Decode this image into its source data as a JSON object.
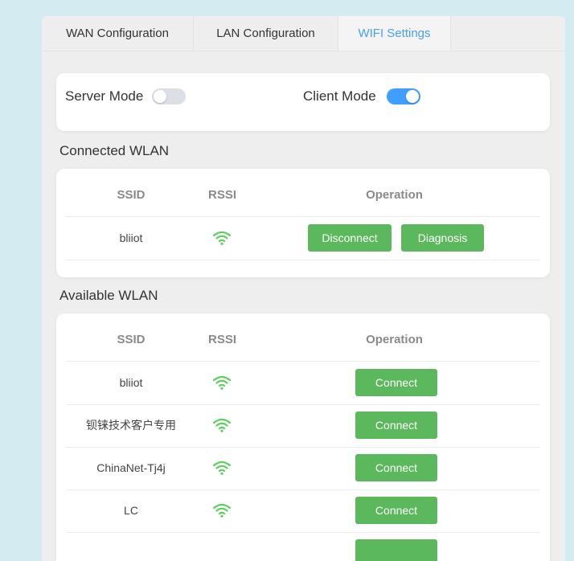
{
  "tabs": [
    {
      "label": "WAN Configuration"
    },
    {
      "label": "LAN Configuration"
    },
    {
      "label": "WIFI Settings",
      "active": true
    }
  ],
  "modes": {
    "server_label": "Server Mode",
    "server_on": false,
    "client_label": "Client Mode",
    "client_on": true
  },
  "connected": {
    "title": "Connected WLAN",
    "headers": {
      "ssid": "SSID",
      "rssi": "RSSI",
      "operation": "Operation"
    },
    "rows": [
      {
        "ssid": "bliiot",
        "rssi_icon": "wifi-icon",
        "actions": [
          "Disconnect",
          "Diagnosis"
        ]
      }
    ]
  },
  "available": {
    "title": "Available WLAN",
    "headers": {
      "ssid": "SSID",
      "rssi": "RSSI",
      "operation": "Operation"
    },
    "rows": [
      {
        "ssid": "bliiot",
        "rssi_icon": "wifi-icon",
        "action": "Connect"
      },
      {
        "ssid": "钡铼技术客户专用",
        "rssi_icon": "wifi-icon",
        "action": "Connect"
      },
      {
        "ssid": "ChinaNet-Tj4j",
        "rssi_icon": "wifi-icon",
        "action": "Connect"
      },
      {
        "ssid": "LC",
        "rssi_icon": "wifi-icon",
        "action": "Connect"
      }
    ]
  },
  "colors": {
    "accent": "#409eff",
    "button_green": "#5cb85c",
    "wifi_green": "#5bd15b",
    "page_bg": "#d5ebf2"
  }
}
